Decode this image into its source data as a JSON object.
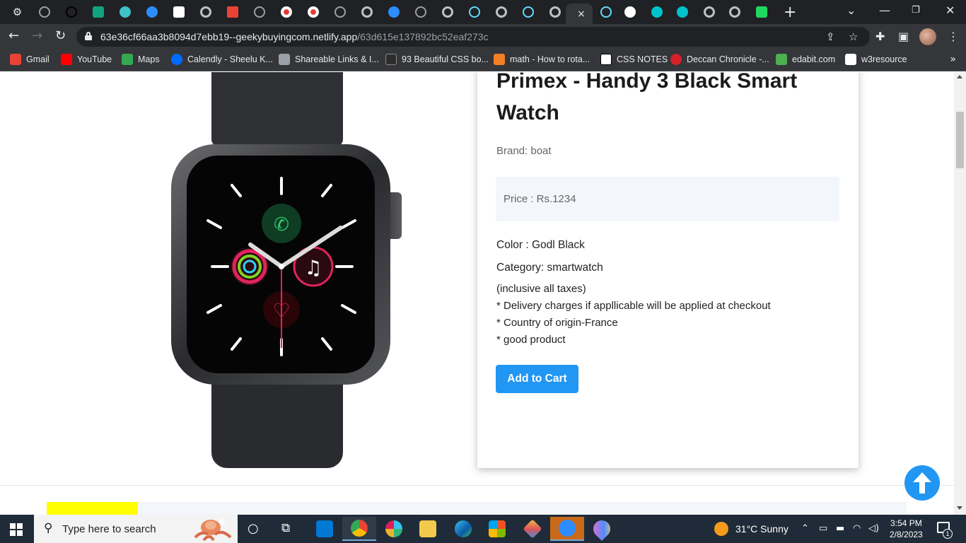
{
  "browser": {
    "url_host": "63e36cf66aa3b8094d7ebb19--geekybuyingcom.netlify.app",
    "url_path": "/63d615e137892bc52eaf273c",
    "tab_close": "×",
    "new_tab": "+",
    "bookmarks": [
      {
        "label": "Gmail",
        "color": "#ea4335"
      },
      {
        "label": "YouTube",
        "color": "#ff0000"
      },
      {
        "label": "Maps",
        "color": "#34a853"
      },
      {
        "label": "Calendly - Sheelu K...",
        "color": "#006bff"
      },
      {
        "label": "Shareable Links & I...",
        "color": "#9aa0a6"
      },
      {
        "label": "93 Beautiful CSS bo...",
        "color": "#2d2d2d"
      },
      {
        "label": "math - How to rota...",
        "color": "#f48024"
      },
      {
        "label": "CSS NOTES",
        "color": "#ffffff"
      },
      {
        "label": "Deccan Chronicle -...",
        "color": "#d4202b"
      },
      {
        "label": "edabit.com",
        "color": "#4caf50"
      },
      {
        "label": "w3resource",
        "color": "#ffffff"
      }
    ],
    "more_bookmarks": "»"
  },
  "product": {
    "title": "Primex - Handy 3 Black Smart Watch",
    "brand": "Brand: boat",
    "price": "Price : Rs.1234",
    "color": "Color :  Godl Black",
    "category": "Category:  smartwatch",
    "notes": [
      "(inclusive all taxes)",
      "* Delivery charges if appllicable will be applied at checkout",
      "* Country of origin-France",
      "* good product"
    ],
    "add_to_cart": "Add to Cart"
  },
  "colors": {
    "accent": "#2196f3",
    "price_bg": "#f3f6fa",
    "highlight": "#ffff00"
  },
  "taskbar": {
    "search_placeholder": "Type here to search",
    "weather": "31°C  Sunny",
    "time": "3:54 PM",
    "date": "2/8/2023",
    "notification_count": "1"
  }
}
